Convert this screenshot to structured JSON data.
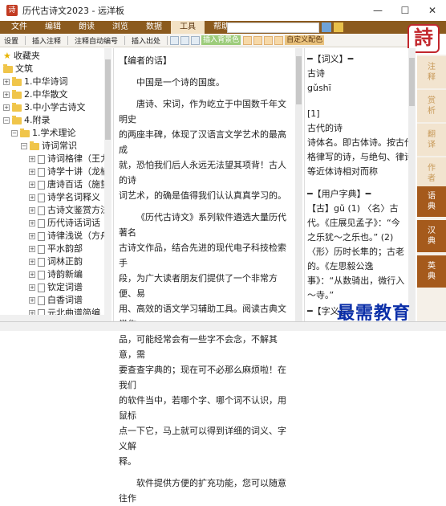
{
  "window": {
    "title": "历代古诗文2023 - 远洋板",
    "app_icon": "诗",
    "min": "—",
    "max": "☐",
    "close": "✕"
  },
  "menu": [
    "文件",
    "编辑",
    "朗读",
    "浏览",
    "数据",
    "工具",
    "帮助"
  ],
  "menu_active": "工具",
  "toolbar": {
    "settings": "设置",
    "insert_note": "插入注释",
    "auto_number": "注释自动编号",
    "insert_source": "插入出处",
    "insert_bg": "插入背景色",
    "custom_color": "自定义配色"
  },
  "logo_text": "詩",
  "tree": {
    "favorites": "收藏夹",
    "library": "文筑",
    "item1": "1.中华诗词",
    "item2": "2.中华散文",
    "item3": "3.中小学古诗文",
    "item4": "4.附录",
    "item4_1": "1.学术理论",
    "item4_1_1": "诗词常识",
    "docs": [
      "诗词格律（王力",
      "诗学十讲（龙榆",
      "唐诗百话（施蛰",
      "诗学名词释义（",
      "古诗文鉴赏方法",
      "历代诗话词话",
      "诗律浅说（方舟",
      "平水韵部",
      "词林正韵",
      "诗韵新编",
      "钦定词谱",
      "白香词谱",
      "元北曲谱简编"
    ]
  },
  "editor": {
    "heading": "【编者的话】",
    "p1": "中国是一个诗的国度。",
    "p2": [
      "唐诗、宋词，作为屹立于中国数千年文明史",
      "的两座丰碑，体现了汉语言文学艺术的最高成",
      "就，恐怕我们后人永远无法望其项背！古人的诗",
      "词艺术，的确是值得我们认认真真学习的。"
    ],
    "p3": [
      "《历代古诗文》系列软件遴选大量历代著名",
      "古诗文作品，结合先进的现代电子科技检索手",
      "段，为广大读者朋友们提供了一个非常方便、易",
      "用、高效的语文学习辅助工具。阅读古典文学作",
      "品，可能经常会有一些字不会念，不解其意，需",
      "要查查字典的；现在可不必那么麻烦啦！在我们",
      "的软件当中，若哪个字、哪个词不认识，用鼠标",
      "点一下它，马上就可以得到详细的词义、字义解",
      "释。"
    ],
    "p4": "软件提供方便的扩充功能，您可以随意往作"
  },
  "dict": {
    "sec1": "━【词义】━",
    "word": "古诗",
    "pinyin": "gǔshī",
    "idx": "[1]",
    "l1": "古代的诗",
    "l2": "诗体名。即古体诗。按古代",
    "l3": "格律写的诗，与绝句、律诗",
    "l4": "等近体诗相对而称",
    "sec2": "━【用户字典】━",
    "c1": "【古】gǔ (1) 〈名〉古",
    "c2": "代。《庄展见孟子》：“今",
    "c3": "之乐犹～之乐也。” (2)",
    "c4": "〈形〉历时长隼的；古老",
    "c5": "的。《左思毅公逸",
    "c6": "事》：“从数骑出，微行入",
    "c7": "～寺。”",
    "sec3": "━【字义】━"
  },
  "sidetabs": [
    "注释",
    "赏析",
    "翻译",
    "作者",
    "语典",
    "汉典",
    "英典"
  ],
  "watermark": "最需教育"
}
